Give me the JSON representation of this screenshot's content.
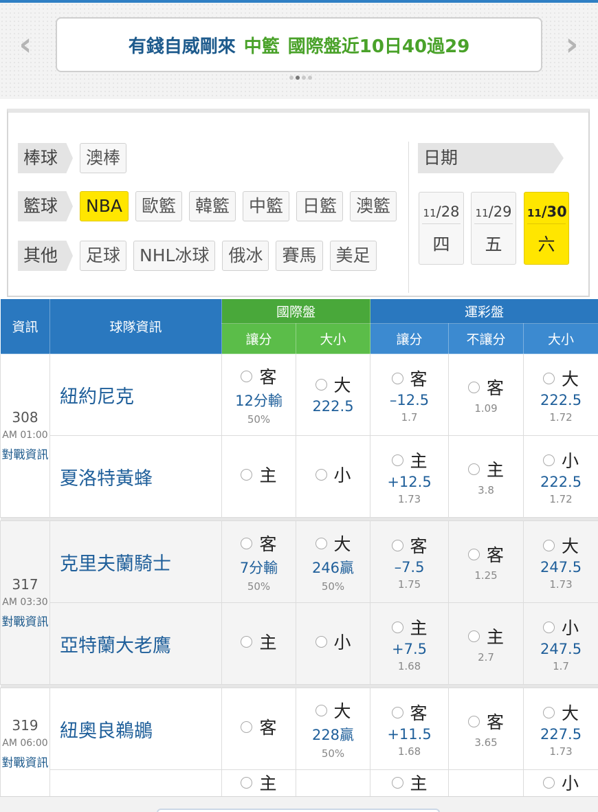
{
  "banner": {
    "prev_icon": "chevron-left-icon",
    "next_icon": "chevron-right-icon",
    "part1": "有錢自威剛來",
    "part2": "中籃",
    "part3": "國際盤近10日40過29"
  },
  "categories": [
    {
      "label": "棒球",
      "chips": [
        {
          "label": "澳棒",
          "active": false
        }
      ]
    },
    {
      "label": "籃球",
      "chips": [
        {
          "label": "NBA",
          "active": true
        },
        {
          "label": "歐籃",
          "active": false
        },
        {
          "label": "韓籃",
          "active": false
        },
        {
          "label": "中籃",
          "active": false
        },
        {
          "label": "日籃",
          "active": false
        },
        {
          "label": "澳籃",
          "active": false
        }
      ]
    },
    {
      "label": "其他",
      "chips": [
        {
          "label": "足球",
          "active": false
        },
        {
          "label": "NHL冰球",
          "active": false
        },
        {
          "label": "俄冰",
          "active": false
        },
        {
          "label": "賽馬",
          "active": false
        },
        {
          "label": "美足",
          "active": false
        }
      ]
    }
  ],
  "date_label": "日期",
  "dates": [
    {
      "month": "11",
      "day": "28",
      "weekday": "四",
      "active": false
    },
    {
      "month": "11",
      "day": "29",
      "weekday": "五",
      "active": false
    },
    {
      "month": "11",
      "day": "30",
      "weekday": "六",
      "active": true
    }
  ],
  "table": {
    "h_info": "資訊",
    "h_team": "球隊資訊",
    "h_intl": "國際盤",
    "h_sport": "運彩盤",
    "h_intl_spread": "讓分",
    "h_intl_total": "大小",
    "h_sport_spread": "讓分",
    "h_sport_ml": "不讓分",
    "h_sport_total": "大小",
    "vs_label": "對戰資訊"
  },
  "games": [
    {
      "num": "308",
      "time": "AM 01:00",
      "away": {
        "team": "紐約尼克",
        "intl_spread": {
          "side": "客",
          "line": "12分輸",
          "pct": "50%"
        },
        "intl_total": {
          "side": "大",
          "line": "222.5",
          "pct": ""
        },
        "sp_spread": {
          "side": "客",
          "line": "–12.5",
          "odds": "1.7"
        },
        "sp_ml": {
          "side": "客",
          "odds": "1.09"
        },
        "sp_total": {
          "side": "大",
          "line": "222.5",
          "odds": "1.72"
        }
      },
      "home": {
        "team": "夏洛特黃蜂",
        "intl_spread": {
          "side": "主",
          "line": "",
          "pct": ""
        },
        "intl_total": {
          "side": "小",
          "line": "",
          "pct": ""
        },
        "sp_spread": {
          "side": "主",
          "line": "+12.5",
          "odds": "1.73"
        },
        "sp_ml": {
          "side": "主",
          "odds": "3.8"
        },
        "sp_total": {
          "side": "小",
          "line": "222.5",
          "odds": "1.72"
        }
      }
    },
    {
      "num": "317",
      "time": "AM 03:30",
      "away": {
        "team": "克里夫蘭騎士",
        "intl_spread": {
          "side": "客",
          "line": "7分輸",
          "pct": "50%"
        },
        "intl_total": {
          "side": "大",
          "line": "246贏",
          "pct": "50%"
        },
        "sp_spread": {
          "side": "客",
          "line": "–7.5",
          "odds": "1.75"
        },
        "sp_ml": {
          "side": "客",
          "odds": "1.25"
        },
        "sp_total": {
          "side": "大",
          "line": "247.5",
          "odds": "1.73"
        }
      },
      "home": {
        "team": "亞特蘭大老鷹",
        "intl_spread": {
          "side": "主",
          "line": "",
          "pct": ""
        },
        "intl_total": {
          "side": "小",
          "line": "",
          "pct": ""
        },
        "sp_spread": {
          "side": "主",
          "line": "+7.5",
          "odds": "1.68"
        },
        "sp_ml": {
          "side": "主",
          "odds": "2.7"
        },
        "sp_total": {
          "side": "小",
          "line": "247.5",
          "odds": "1.7"
        }
      }
    },
    {
      "num": "319",
      "time": "AM 06:00",
      "away": {
        "team": "紐奧良鵜鶘",
        "intl_spread": {
          "side": "客",
          "line": "",
          "pct": ""
        },
        "intl_total": {
          "side": "大",
          "line": "228贏",
          "pct": "50%"
        },
        "sp_spread": {
          "side": "客",
          "line": "+11.5",
          "odds": "1.68"
        },
        "sp_ml": {
          "side": "客",
          "odds": "3.65"
        },
        "sp_total": {
          "side": "大",
          "line": "227.5",
          "odds": "1.73"
        }
      },
      "home": {
        "team": "",
        "intl_spread": {
          "side": "主",
          "line": "",
          "pct": ""
        },
        "intl_total": {
          "side": "",
          "line": "",
          "pct": ""
        },
        "sp_spread": {
          "side": "主",
          "line": "",
          "odds": ""
        },
        "sp_ml": {
          "side": "",
          "odds": ""
        },
        "sp_total": {
          "side": "小",
          "line": "",
          "odds": ""
        }
      }
    }
  ]
}
